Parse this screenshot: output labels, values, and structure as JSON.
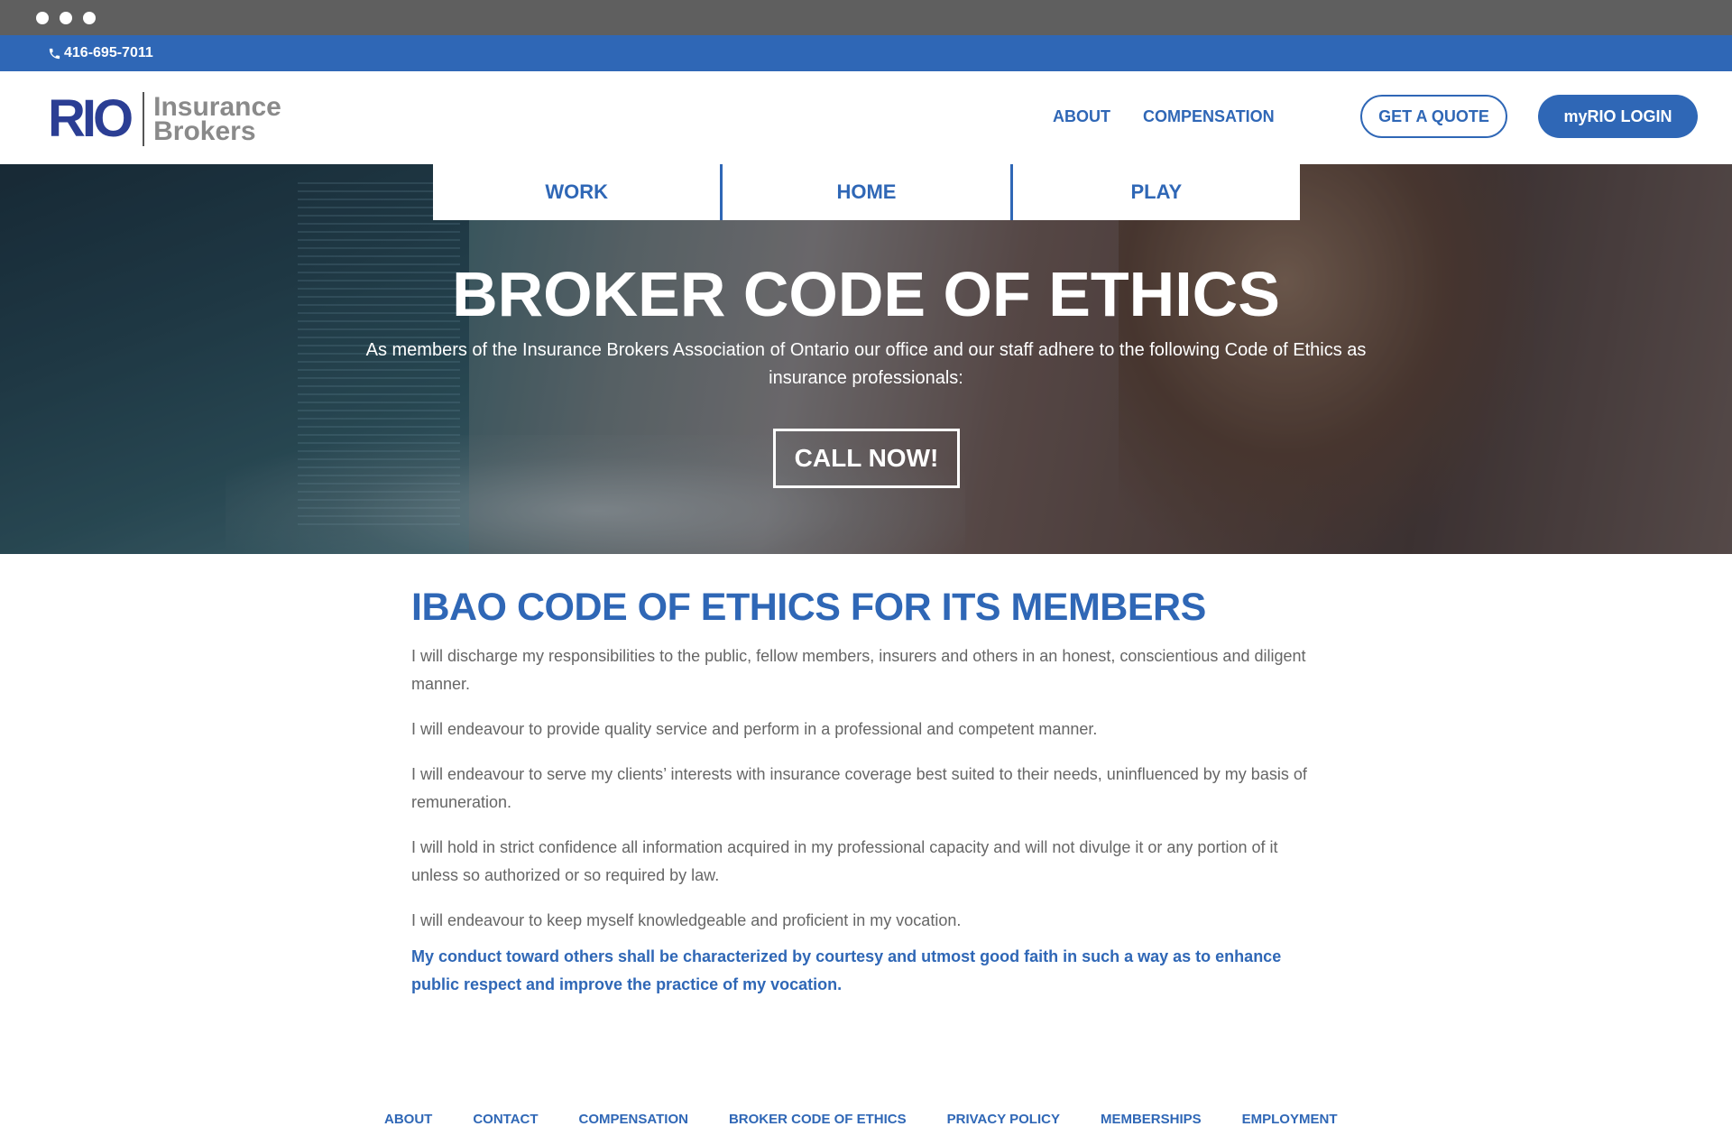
{
  "topbar": {
    "phone": "416-695-7011",
    "phone_icon": "phone-icon"
  },
  "header": {
    "logo": {
      "mark": "RIO",
      "line1": "Insurance",
      "line2": "Brokers"
    },
    "nav": [
      {
        "label": "ABOUT"
      },
      {
        "label": "COMPENSATION"
      }
    ],
    "quote_button": "GET A QUOTE",
    "login_button": "myRIO LOGIN",
    "brand_color": "#2f67b6"
  },
  "tabs": [
    {
      "label": "WORK"
    },
    {
      "label": "HOME"
    },
    {
      "label": "PLAY"
    }
  ],
  "hero": {
    "title": "BROKER CODE OF ETHICS",
    "subtitle": "As members of the Insurance Brokers Association of Ontario our office and our staff adhere to the following Code of Ethics as insurance professionals:",
    "cta": "CALL NOW!"
  },
  "content": {
    "title": "IBAO CODE OF ETHICS FOR ITS MEMBERS",
    "paragraphs": [
      "I will discharge my responsibilities to the public, fellow members, insurers and others in an honest, conscientious and diligent manner.",
      "I will endeavour to provide quality service and perform in a professional and competent manner.",
      "I will endeavour to serve my clients’ interests with insurance coverage best suited to their needs, uninfluenced by my basis of remuneration.",
      "I will hold in strict confidence all information acquired in my professional capacity and will not divulge it or any portion of it unless so authorized or so required by law.",
      "I will endeavour to keep myself knowledgeable and proficient in my vocation."
    ],
    "closing": "My conduct toward others shall be characterized by courtesy and utmost good faith in such a way as to enhance public respect and improve the practice of my vocation."
  },
  "footer": {
    "links": [
      {
        "label": "ABOUT"
      },
      {
        "label": "CONTACT"
      },
      {
        "label": "COMPENSATION"
      },
      {
        "label": "BROKER CODE OF ETHICS"
      },
      {
        "label": "PRIVACY POLICY"
      },
      {
        "label": "MEMBERSHIPS"
      },
      {
        "label": "EMPLOYMENT"
      }
    ]
  }
}
